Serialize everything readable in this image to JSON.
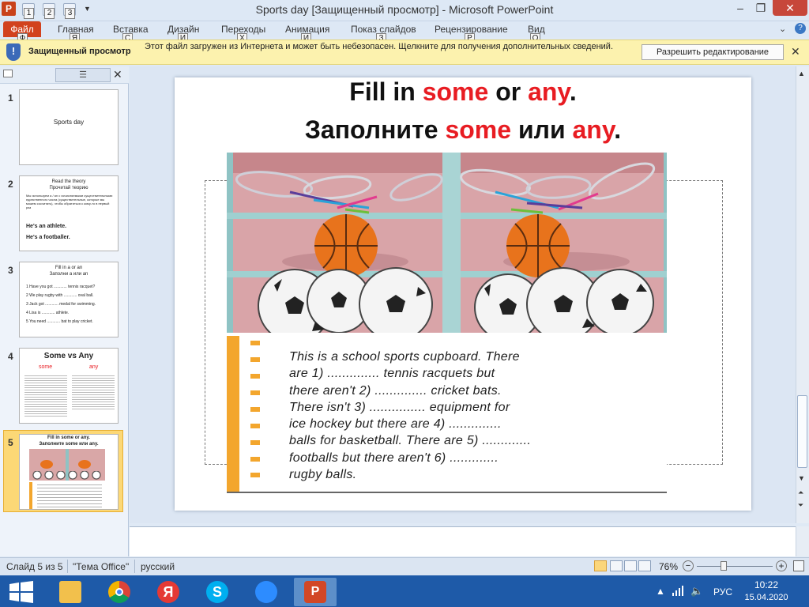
{
  "window": {
    "title": "Sports day [Защищенный просмотр]  -  Microsoft PowerPoint",
    "app_icon": "P",
    "min": "–",
    "max": "❐",
    "close": "✕"
  },
  "ribbon": {
    "file_tab": "Файл",
    "tabs": [
      "Главная",
      "Вставка",
      "Дизайн",
      "Переходы",
      "Анимация",
      "Показ слайдов",
      "Рецензирование",
      "Вид"
    ],
    "keytips": [
      "Ф",
      "Я",
      "С",
      "И",
      "Х",
      "И",
      "З",
      "Р",
      "О"
    ],
    "qat_keytips": [
      "1",
      "2",
      "3"
    ]
  },
  "protected_view": {
    "title": "Защищенный просмотр",
    "message": "Этот файл загружен из Интернета и может быть небезопасен. Щелкните для получения дополнительных сведений.",
    "button": "Разрешить редактирование",
    "close": "✕"
  },
  "slide_panel": {
    "close": "✕",
    "thumb1": {
      "text": "Sports day"
    },
    "thumb2": {
      "title1": "Read the theory",
      "title2": "Прочитай теорию",
      "body": "Мы используем a / an с исчисляемыми существительными единственного числа (существительные, которые мы можем сосчитать), чтобы обратиться к кому-то в первый раз",
      "line1": "He's an athlete.",
      "line2": "He's a footballer."
    },
    "thumb3": {
      "title1": "Fill in a or an",
      "title2": "Заполни a или an",
      "items": [
        "1   Have you got ............ tennis racquet?",
        "2   We play rugby with ............ oval ball.",
        "3   Jack got ............ medal for swimming.",
        "4   Lisa is ............ athlete.",
        "5   You need ............ bat to play cricket."
      ]
    },
    "thumb4": {
      "title": "Some  vs   Any",
      "left_head": "some",
      "right_head": "any"
    },
    "thumb5": {
      "title1": "Fill in some or any.",
      "title2": "Заполните some или any."
    }
  },
  "slide": {
    "title1": [
      "Fill in ",
      "some",
      " or ",
      "any",
      "."
    ],
    "title2": [
      "Заполните ",
      "some",
      " или ",
      "any",
      "."
    ],
    "exercise_lines": [
      "This is a school sports cupboard. There",
      "are 1) .............. tennis racquets but",
      "there aren't 2) .............. cricket bats.",
      "There isn't 3) ............... equipment for",
      "ice hockey but there are 4) ..............",
      "balls for basketball. There are 5) .............",
      "footballs but there aren't 6) .............",
      "rugby balls."
    ]
  },
  "status": {
    "slide": "Слайд 5 из 5",
    "theme": "\"Тема Office\"",
    "language": "русский",
    "zoom": "76%"
  },
  "taskbar": {
    "lang": "РУС",
    "time": "10:22",
    "date": "15.04.2020"
  },
  "colors": {
    "accent_red": "#e81c22",
    "file_tab": "#d2421e",
    "protected_bar": "#fcf2ae",
    "taskbar": "#1e5aa8"
  }
}
